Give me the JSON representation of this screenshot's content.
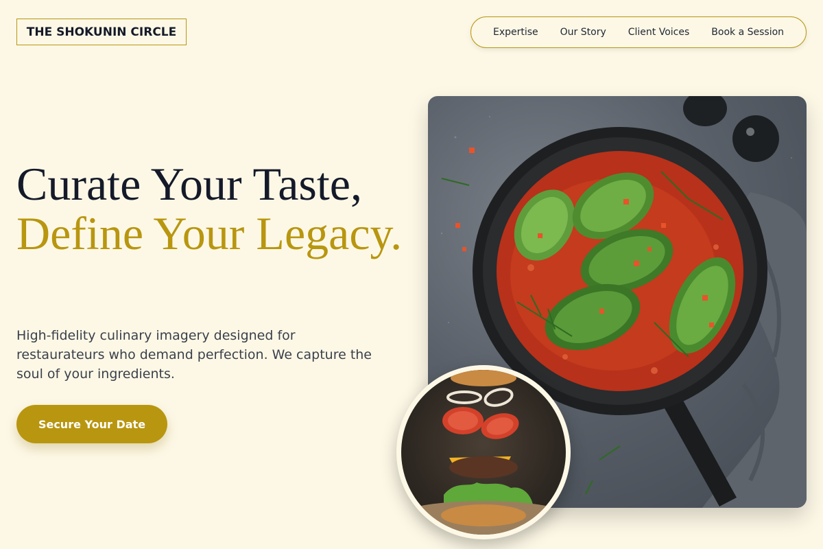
{
  "brand": {
    "name": "THE SHOKUNIN CIRCLE"
  },
  "nav": {
    "items": [
      "Expertise",
      "Our Story",
      "Client Voices",
      "Book a Session"
    ]
  },
  "hero": {
    "title_line1": "Curate Your Taste,",
    "title_line2": "Define Your Legacy.",
    "subtitle": "High-fidelity culinary imagery designed for restaurateurs who demand perfection. We capture the soul of your ingredients.",
    "cta_label": "Secure Your Date"
  },
  "images": {
    "main": "skillet-cabbage-rolls-photo",
    "secondary": "floating-burger-photo"
  },
  "colors": {
    "background": "#fdf8e6",
    "accent": "#b8960f",
    "text_dark": "#141a29"
  }
}
